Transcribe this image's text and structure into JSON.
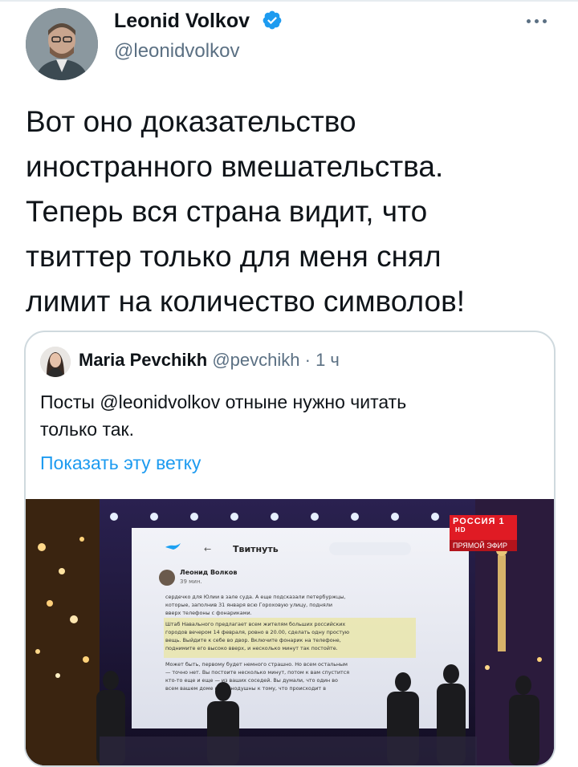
{
  "colors": {
    "accent": "#1d9bf0",
    "verified": "#1d9bf0",
    "secondary_text": "#5b7083",
    "border": "#cfd9de"
  },
  "author": {
    "name": "Leonid Volkov",
    "handle": "@leonidvolkov",
    "verified": true
  },
  "tweet": {
    "text": "Вот оно доказательство\nиностранного вмешательства.\nТеперь вся страна видит, что\nтвиттер только для меня снял\nлимит на количество символов!"
  },
  "quoted": {
    "name": "Maria Pevchikh",
    "handle": "@pevchikh",
    "separator": "·",
    "time": "1 ч",
    "text": "Посты @leonidvolkov отныне нужно читать\nтолько так.",
    "show_thread": "Показать эту ветку"
  },
  "media": {
    "channel": "РОССИЯ 1",
    "hd": "HD",
    "live": "ПРЯМОЙ ЭФИР",
    "screen": {
      "back": "←",
      "title": "Твитнуть",
      "author": "Леонид Волков",
      "time": "39 мин.",
      "lines": [
        "сердечко для Юлии в зале суда. А еще подсказали петербуржцы,",
        "которые, заполнив 31 января всю Гороховую улицу, подняли",
        "вверх телефоны с фонариками.",
        "Штаб Навального предлагает всем жителям больших российских",
        "городов вечером 14 февраля, ровно в 20.00, сделать одну простую",
        "вещь. Выйдите к себе во двор. Включите фонарик на телефоне,",
        "поднимите его высоко вверх, и несколько минут так постойте.",
        "Может быть, первому будет немного страшно. Но всем остальным",
        "— точно нет. Вы постоите несколько минут, потом к вам спустится",
        "кто-то еще и еще — из ваших соседей. Вы думали, что один во",
        "всем вашем доме неравнодушны к тому, что происходит в"
      ]
    }
  }
}
